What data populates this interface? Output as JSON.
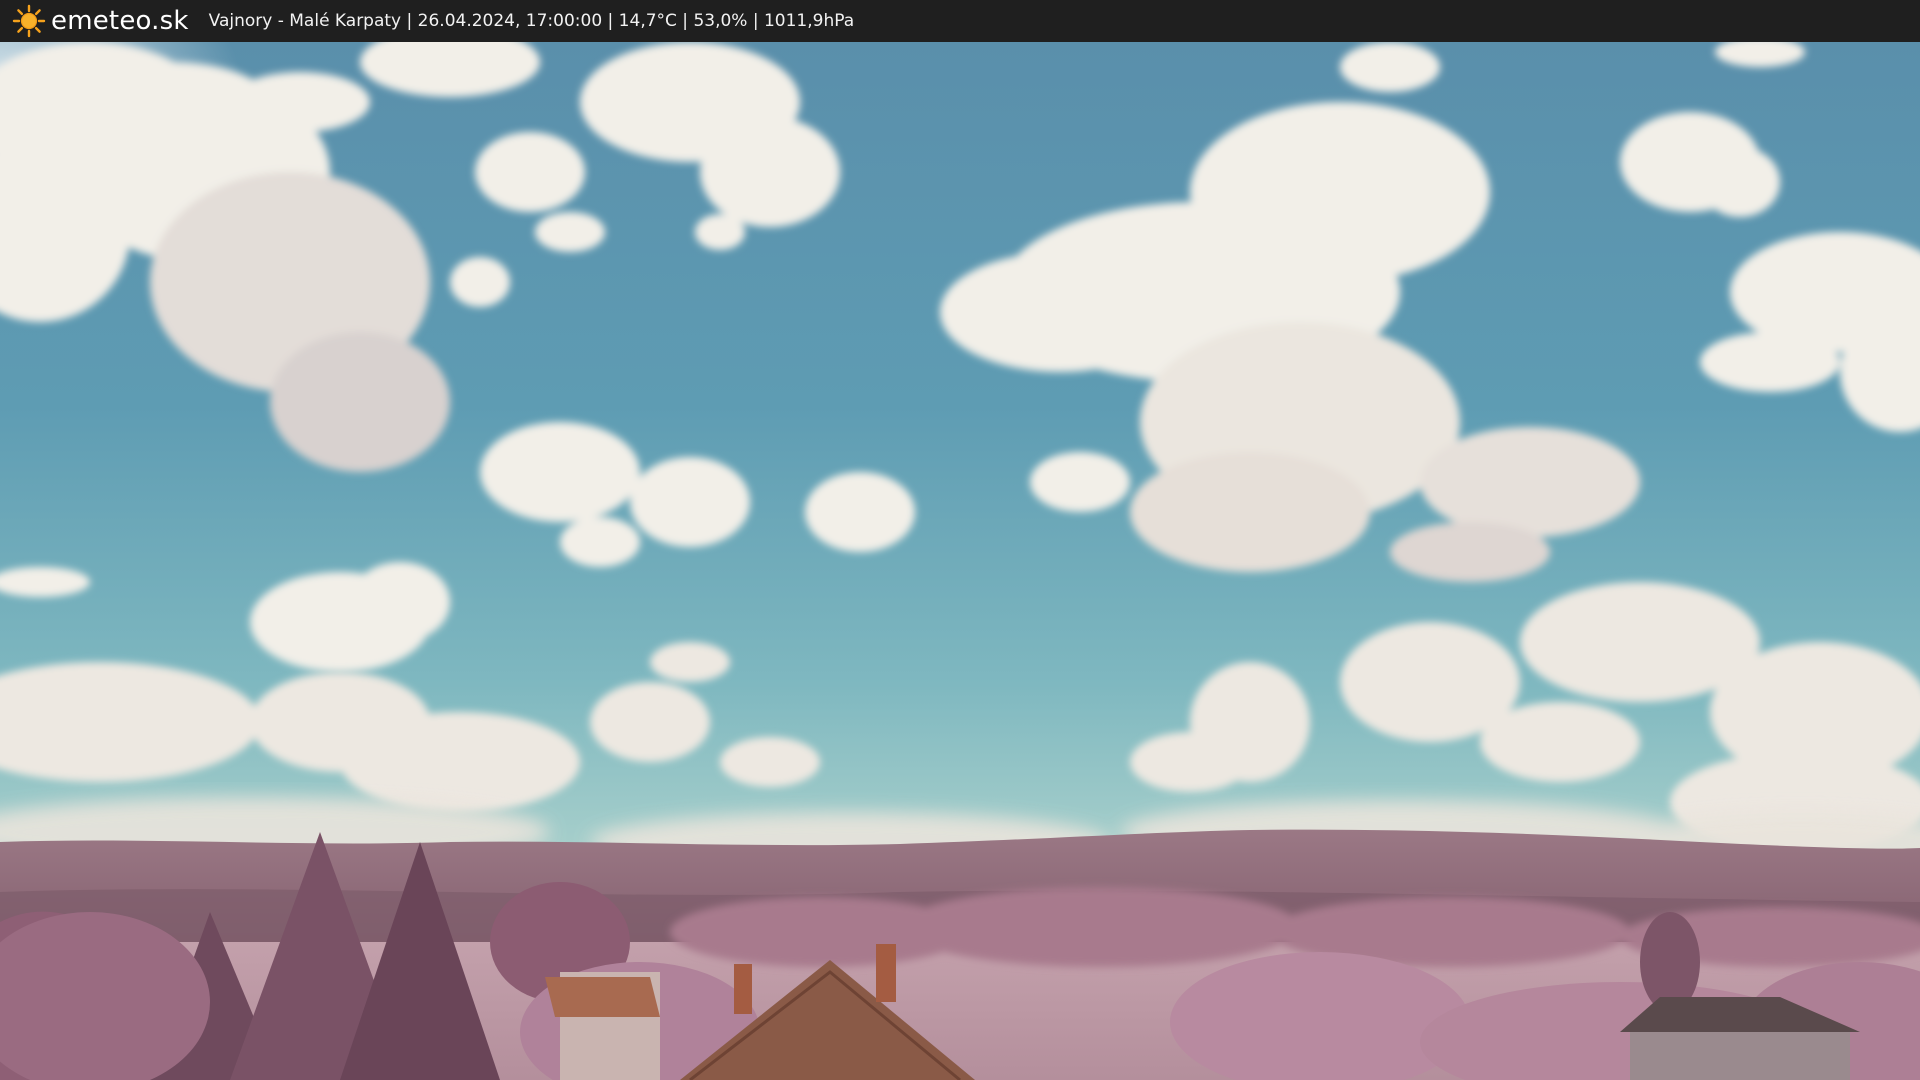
{
  "header": {
    "brand": "emeteo.sk",
    "caption": "Vajnory - Malé Karpaty | 26.04.2024, 17:00:00 | 14,7°C | 53,0% | 1011,9hPa",
    "logo_icon": "sun-icon"
  },
  "colors": {
    "bar": "#1f1f1f",
    "sky_top": "#5e93ac",
    "sky_horizon": "#8fc3c7",
    "cloud": "#f4f1ea",
    "hills": "#8c6a78",
    "foliage": "#b8879a",
    "field": "#c9a3ad",
    "roof": "#8a5a47"
  }
}
